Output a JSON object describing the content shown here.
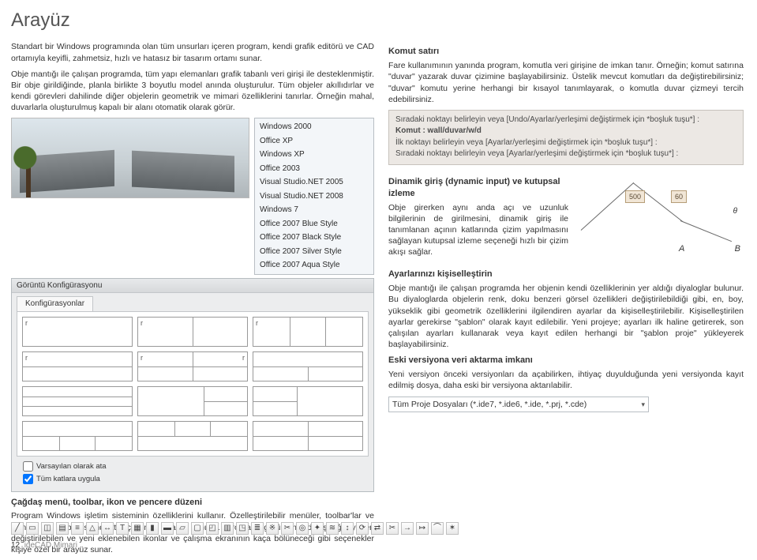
{
  "page": {
    "title": "Arayüz",
    "footer_page": "12",
    "footer_product": "ideCAD Mimari"
  },
  "left": {
    "p1": "Standart bir Windows programında olan tüm unsurları içeren program, kendi grafik editörü ve CAD ortamıyla keyifli, zahmetsiz, hızlı ve hatasız bir tasarım ortamı sunar.",
    "p2": "Obje mantığı ile çalışan programda, tüm yapı elemanları grafik tabanlı veri girişi ile desteklenmiştir. Bir obje girildiğinde, planla birlikte 3 boyutlu model anında oluşturulur. Tüm objeler akıllıdırlar ve kendi görevleri dahilinde diğer objelerin geometrik ve mimari özelliklerini tanırlar. Örneğin mahal, duvarlarla oluşturulmuş kapalı bir alanı otomatik olarak görür.",
    "theme_menu": [
      "Windows 2000",
      "Office XP",
      "Windows XP",
      "Office 2003",
      "Visual Studio.NET 2005",
      "Visual Studio.NET 2008",
      "Windows 7",
      "Office 2007 Blue Style",
      "Office 2007 Black Style",
      "Office 2007 Silver Style",
      "Office 2007 Aqua Style"
    ],
    "panel_title": "Görüntü Konfigürasyonu",
    "panel_tab": "Konfigürasyonlar",
    "check1": "Varsayılan olarak ata",
    "check2": "Tüm katlara uygula",
    "sec2_title": "Çağdaş menü, toolbar, ikon ve pencere düzeni",
    "sec2_p": "Program Windows işletim sisteminin özelliklerini kullanır. Özelleştirilebilir menüler, toolbar'lar ve ikonlar ile global standartta çalışma ortamı sunulur. Program görünümü değişikliği, yerleri değiştirilebilen ve yeni eklenebilen ikonlar ve çalışma ekranının kaça bölüneceği gibi seçenekler kişiye özel bir arayüz sunar."
  },
  "right": {
    "sec1_title": "Komut satırı",
    "sec1_p": "Fare kullanımının yanında program, komutla veri girişine de imkan tanır. Örneğin; komut satırına \"duvar\" yazarak duvar çizimine başlayabilirsiniz. Üstelik mevcut komutları da değiştirebilirsiniz; \"duvar\" komutu yerine herhangi bir kısayol tanımlayarak, o komutla duvar çizmeyi tercih edebilirsiniz.",
    "cmd_line1": "Sıradaki noktayı belirleyin veya [Undo/Ayarlar/yerleşimi değiştirmek için *boşluk tuşu*] :",
    "cmd_line2": "Komut : wall/duvar/w/d",
    "cmd_line3": "İlk noktayı belirleyin veya [Ayarlar/yerleşimi değiştirmek için *boşluk tuşu*] :",
    "cmd_line4": "Sıradaki noktayı belirleyin veya [Ayarlar/yerleşimi değiştirmek için *boşluk tuşu*] :",
    "sec2_title": "Dinamik giriş (dynamic input) ve kutupsal izleme",
    "sec2_p": "Obje girerken aynı anda açı ve uzunluk bilgilerinin de girilmesini, dinamik giriş ile tanımlanan açının katlarında çizim yapılmasını sağlayan kutupsal izleme seçeneği hızlı bir çizim akışı sağlar.",
    "dim_a": "500",
    "dim_b": "60",
    "pt_a": "A",
    "pt_b": "B",
    "sec3_title": "Ayarlarınızı kişiselleştirin",
    "sec3_p": "Obje mantığı ile çalışan programda her objenin kendi özelliklerinin yer aldığı diyaloglar bulunur. Bu diyaloglarda objelerin renk, doku benzeri görsel özellikleri değiştirilebildiği gibi, en, boy, yükseklik gibi geometrik özelliklerini ilgilendiren ayarlar da kişiselleştirilebilir. Kişiselleştirilen ayarlar gerekirse \"şablon\" olarak kayıt edilebilir. Yeni projeye; ayarları ilk haline getirerek, son çalışılan ayarları kullanarak veya kayıt edilen herhangi bir \"şablon proje\" yükleyerek başlayabilirsiniz.",
    "sec4_title": "Eski versiyona veri aktarma imkanı",
    "sec4_p": "Yeni versiyon önceki versiyonları da açabilirken, ihtiyaç duyulduğunda yeni versiyonda kayıt edilmiş dosya, daha eski bir versiyona aktarılabilir.",
    "file_types": "Tüm Proje Dosyaları (*.ide7, *.ide6, *.ide, *.prj, *.cde)"
  },
  "toolbar_icons": [
    "line-icon",
    "wall-icon",
    "door-icon",
    "floor-icon",
    "stairs-icon",
    "roof-icon",
    "dimension-icon",
    "text-icon",
    "hatch-icon",
    "column-icon",
    "beam-icon",
    "slab-icon",
    "foundation-icon",
    "zone-icon",
    "curtain-icon",
    "window-icon",
    "railing-icon",
    "mesh-icon",
    "section-icon",
    "camera-icon",
    "render-icon",
    "layer-icon",
    "move-icon",
    "rotate-icon",
    "mirror-icon",
    "trim-icon",
    "extend-icon",
    "offset-icon",
    "fillet-icon",
    "explode-icon"
  ]
}
